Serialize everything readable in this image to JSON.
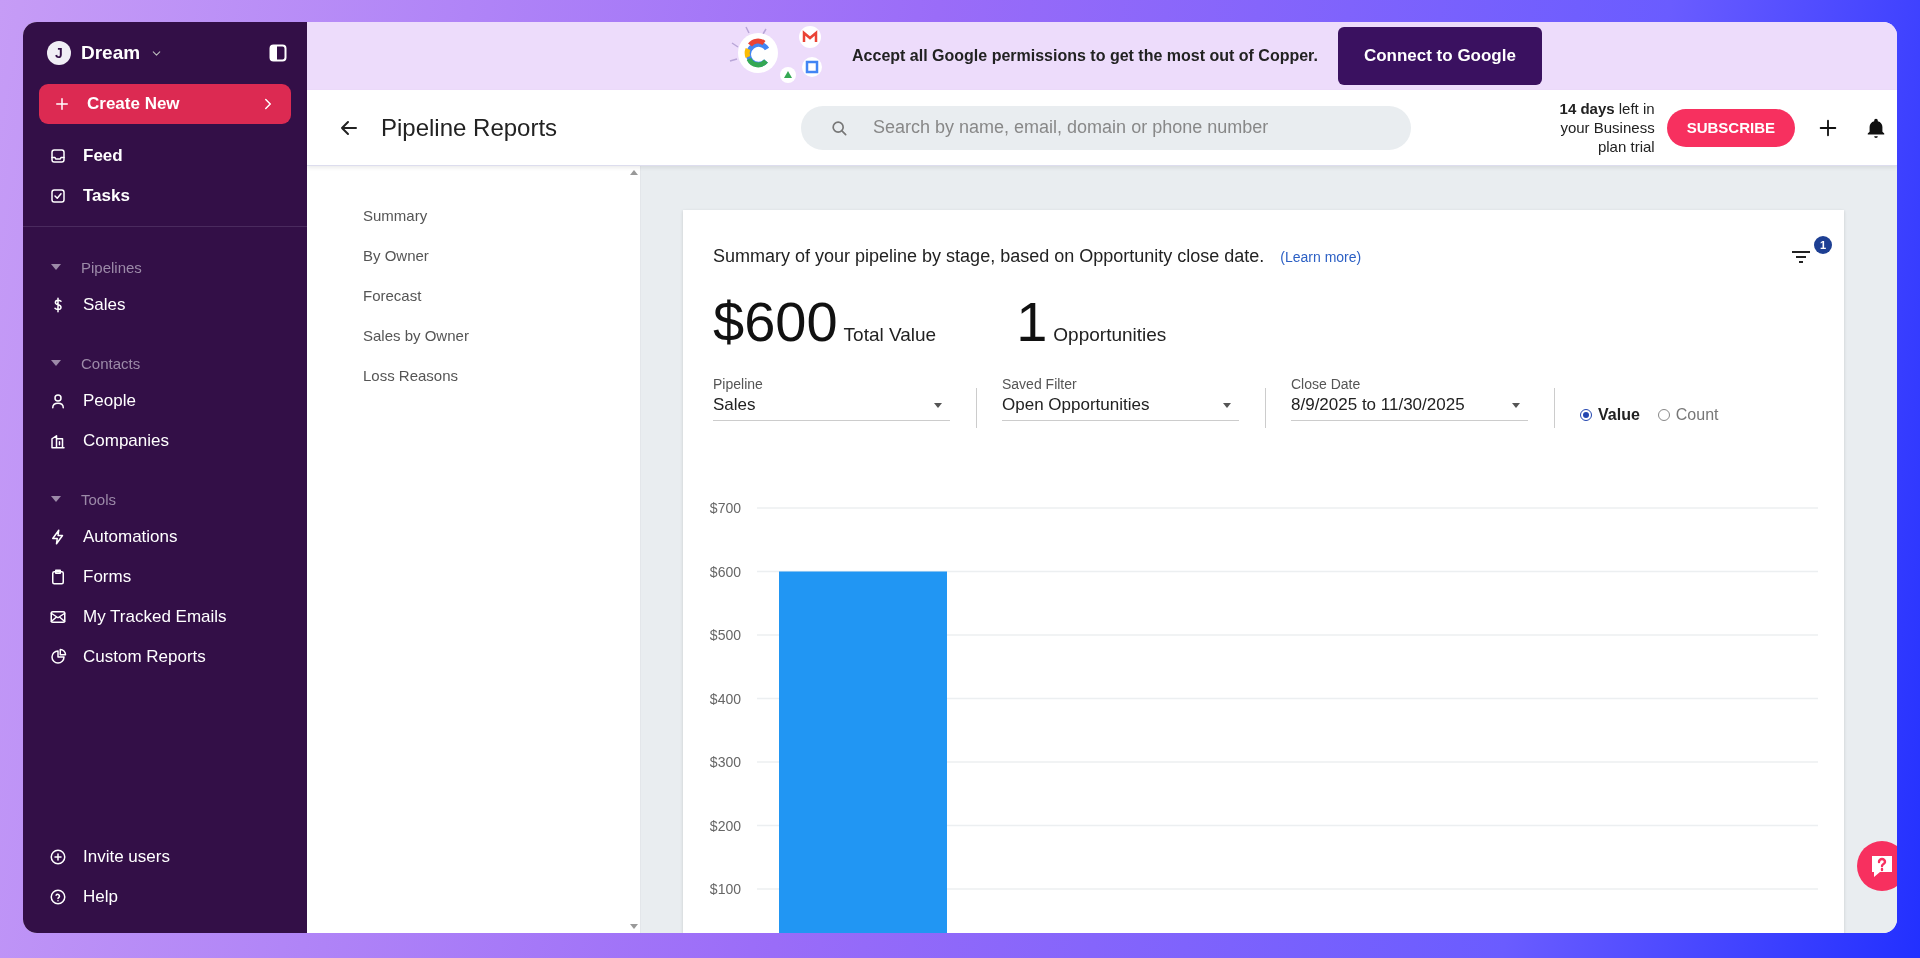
{
  "banner": {
    "message": "Accept all Google permissions to get the most out of Copper.",
    "button": "Connect to Google"
  },
  "sidebar": {
    "workspace": {
      "initial": "J",
      "name": "Dream"
    },
    "create_button": "Create New",
    "top_items": [
      {
        "label": "Feed",
        "selected": false
      },
      {
        "label": "Tasks",
        "selected": false
      }
    ],
    "sections": [
      {
        "title": "Pipelines",
        "expanded": true,
        "items": [
          {
            "label": "Sales",
            "selected": false
          }
        ]
      },
      {
        "title": "Contacts",
        "expanded": true,
        "items": [
          {
            "label": "People",
            "selected": false
          },
          {
            "label": "Companies",
            "selected": false
          }
        ]
      },
      {
        "title": "Tools",
        "expanded": true,
        "items": [
          {
            "label": "Automations",
            "selected": false
          },
          {
            "label": "Forms",
            "selected": false
          },
          {
            "label": "My Tracked Emails",
            "selected": false
          },
          {
            "label": "Custom Reports",
            "selected": false
          }
        ]
      }
    ],
    "footer_items": [
      {
        "label": "Invite users"
      },
      {
        "label": "Help"
      }
    ]
  },
  "header": {
    "title": "Pipeline Reports",
    "search": {
      "placeholder": "Search by name, email, domain or phone number"
    },
    "trial": "**14 days** left in your Business plan trial",
    "subscribe": "SUBSCRIBE"
  },
  "report_nav": [
    {
      "label": "Summary",
      "selected": false
    },
    {
      "label": "By Owner",
      "selected": false
    },
    {
      "label": "Forecast",
      "selected": false
    },
    {
      "label": "Sales by Owner",
      "selected": false
    },
    {
      "label": "Loss Reasons",
      "selected": false
    }
  ],
  "card": {
    "description": "Summary of your pipeline by stage, based on Opportunity close date.",
    "learn_more": "(Learn more)",
    "filter_badge": "1",
    "stats": [
      {
        "value": "$600",
        "label": "Total Value"
      },
      {
        "value": "1",
        "label": "Opportunities"
      }
    ],
    "filters": [
      {
        "label": "Pipeline",
        "value": "Sales"
      },
      {
        "label": "Saved Filter",
        "value": "Open Opportunities"
      },
      {
        "label": "Close Date",
        "value": "8/9/2025 to 11/30/2025"
      }
    ],
    "modes": [
      {
        "label": "Value",
        "selected": true
      },
      {
        "label": "Count",
        "selected": false
      }
    ],
    "chart_data": {
      "type": "bar",
      "grid": true,
      "values": [
        600
      ],
      "ylim": [
        0,
        700
      ],
      "yticks": [
        {
          "value": 100,
          "label": "$100"
        },
        {
          "value": 200,
          "label": "$200"
        },
        {
          "value": 300,
          "label": "$300"
        },
        {
          "value": 400,
          "label": "$400"
        },
        {
          "value": 500,
          "label": "$500"
        },
        {
          "value": 600,
          "label": "$600"
        },
        {
          "value": 700,
          "label": "$700"
        }
      ]
    }
  }
}
